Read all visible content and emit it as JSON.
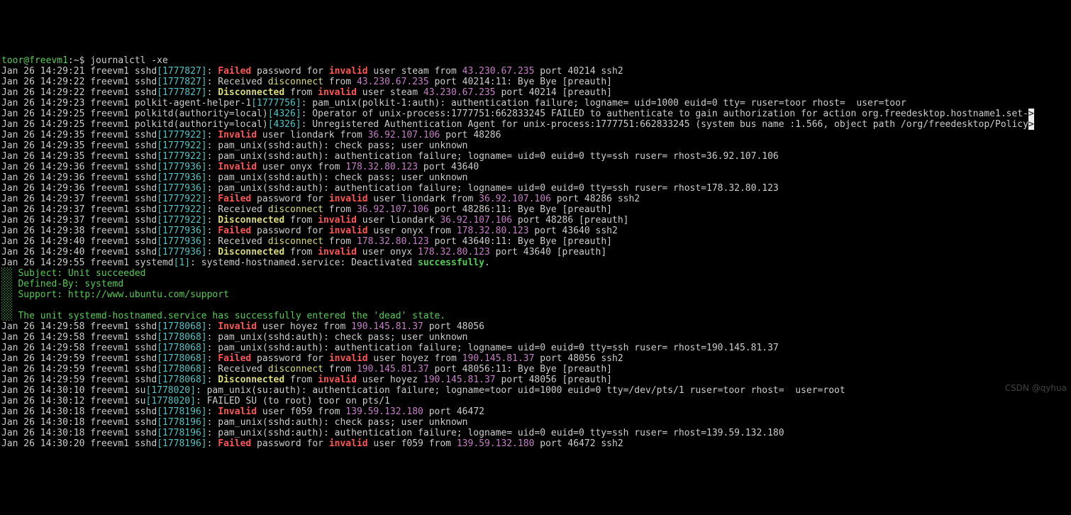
{
  "prompt": {
    "user": "toor@freevm1",
    "path": ":~$ ",
    "command": "journalctl -xe"
  },
  "watermark": "CSDN @qyhua",
  "lines": [
    {
      "segments": [
        {
          "class": "fg-default",
          "text": "Jan 26 14:29:21 freevm1 sshd"
        },
        {
          "class": "fg-cyan",
          "text": "[1777827]"
        },
        {
          "class": "fg-default",
          "text": ": "
        },
        {
          "class": "fg-red-b bold",
          "text": "Failed"
        },
        {
          "class": "fg-default",
          "text": " password for "
        },
        {
          "class": "fg-red-b bold",
          "text": "invalid"
        },
        {
          "class": "fg-default",
          "text": " user steam from "
        },
        {
          "class": "fg-magenta",
          "text": "43.230.67.235"
        },
        {
          "class": "fg-default",
          "text": " port 40214 ssh2"
        }
      ]
    },
    {
      "segments": [
        {
          "class": "fg-default",
          "text": "Jan 26 14:29:22 freevm1 sshd"
        },
        {
          "class": "fg-cyan",
          "text": "[1777827]"
        },
        {
          "class": "fg-default",
          "text": ": Received "
        },
        {
          "class": "fg-yellow",
          "text": "disconnect"
        },
        {
          "class": "fg-default",
          "text": " from "
        },
        {
          "class": "fg-magenta",
          "text": "43.230.67.235"
        },
        {
          "class": "fg-default",
          "text": " port 40214:11: Bye Bye [preauth]"
        }
      ]
    },
    {
      "segments": [
        {
          "class": "fg-default",
          "text": "Jan 26 14:29:22 freevm1 sshd"
        },
        {
          "class": "fg-cyan",
          "text": "[1777827]"
        },
        {
          "class": "fg-default",
          "text": ": "
        },
        {
          "class": "fg-yellow-b",
          "text": "Disconnected"
        },
        {
          "class": "fg-default",
          "text": " from "
        },
        {
          "class": "fg-red-b bold",
          "text": "invalid"
        },
        {
          "class": "fg-default",
          "text": " user steam "
        },
        {
          "class": "fg-magenta",
          "text": "43.230.67.235"
        },
        {
          "class": "fg-default",
          "text": " port 40214 [preauth]"
        }
      ]
    },
    {
      "segments": [
        {
          "class": "fg-default",
          "text": "Jan 26 14:29:23 freevm1 polkit-agent-helper-1"
        },
        {
          "class": "fg-cyan",
          "text": "[1777756]"
        },
        {
          "class": "fg-default",
          "text": ": pam_unix(polkit-1:auth): authentication failure; logname= uid=1000 euid=0 tty= ruser=toor rhost=  user=toor"
        }
      ]
    },
    {
      "segments": [
        {
          "class": "fg-default",
          "text": "Jan 26 14:29:25 freevm1 polkitd(authority=local)"
        },
        {
          "class": "fg-cyan",
          "text": "[4326]"
        },
        {
          "class": "fg-default",
          "text": ": Operator of unix-process:1777751:662833245 FAILED to authenticate to gain authorization for action org.freedesktop.hostname1.set-"
        },
        {
          "class": "bg-white",
          "text": ">"
        }
      ]
    },
    {
      "segments": [
        {
          "class": "fg-default",
          "text": "Jan 26 14:29:25 freevm1 polkitd(authority=local)"
        },
        {
          "class": "fg-cyan",
          "text": "[4326]"
        },
        {
          "class": "fg-default",
          "text": ": Unregistered Authentication Agent for unix-process:1777751:662833245 (system bus name :1.566, object path /org/freedesktop/Policy"
        },
        {
          "class": "bg-white",
          "text": ">"
        }
      ]
    },
    {
      "segments": [
        {
          "class": "fg-default",
          "text": "Jan 26 14:29:35 freevm1 sshd"
        },
        {
          "class": "fg-cyan",
          "text": "[1777922]"
        },
        {
          "class": "fg-default",
          "text": ": "
        },
        {
          "class": "fg-red-b bold",
          "text": "Invalid"
        },
        {
          "class": "fg-default",
          "text": " user liondark from "
        },
        {
          "class": "fg-magenta",
          "text": "36.92.107.106"
        },
        {
          "class": "fg-default",
          "text": " port 48286"
        }
      ]
    },
    {
      "segments": [
        {
          "class": "fg-default",
          "text": "Jan 26 14:29:35 freevm1 sshd"
        },
        {
          "class": "fg-cyan",
          "text": "[1777922]"
        },
        {
          "class": "fg-default",
          "text": ": pam_unix(sshd:auth): check pass; user unknown"
        }
      ]
    },
    {
      "segments": [
        {
          "class": "fg-default",
          "text": "Jan 26 14:29:35 freevm1 sshd"
        },
        {
          "class": "fg-cyan",
          "text": "[1777922]"
        },
        {
          "class": "fg-default",
          "text": ": pam_unix(sshd:auth): authentication failure; logname= uid=0 euid=0 tty=ssh ruser= rhost=36.92.107.106"
        }
      ]
    },
    {
      "segments": [
        {
          "class": "fg-default",
          "text": "Jan 26 14:29:36 freevm1 sshd"
        },
        {
          "class": "fg-cyan",
          "text": "[1777936]"
        },
        {
          "class": "fg-default",
          "text": ": "
        },
        {
          "class": "fg-red-b bold",
          "text": "Invalid"
        },
        {
          "class": "fg-default",
          "text": " user onyx from "
        },
        {
          "class": "fg-magenta",
          "text": "178.32.80.123"
        },
        {
          "class": "fg-default",
          "text": " port 43640"
        }
      ]
    },
    {
      "segments": [
        {
          "class": "fg-default",
          "text": "Jan 26 14:29:36 freevm1 sshd"
        },
        {
          "class": "fg-cyan",
          "text": "[1777936]"
        },
        {
          "class": "fg-default",
          "text": ": pam_unix(sshd:auth): check pass; user unknown"
        }
      ]
    },
    {
      "segments": [
        {
          "class": "fg-default",
          "text": "Jan 26 14:29:36 freevm1 sshd"
        },
        {
          "class": "fg-cyan",
          "text": "[1777936]"
        },
        {
          "class": "fg-default",
          "text": ": pam_unix(sshd:auth): authentication failure; logname= uid=0 euid=0 tty=ssh ruser= rhost=178.32.80.123"
        }
      ]
    },
    {
      "segments": [
        {
          "class": "fg-default",
          "text": "Jan 26 14:29:37 freevm1 sshd"
        },
        {
          "class": "fg-cyan",
          "text": "[1777922]"
        },
        {
          "class": "fg-default",
          "text": ": "
        },
        {
          "class": "fg-red-b bold",
          "text": "Failed"
        },
        {
          "class": "fg-default",
          "text": " password for "
        },
        {
          "class": "fg-red-b bold",
          "text": "invalid"
        },
        {
          "class": "fg-default",
          "text": " user liondark from "
        },
        {
          "class": "fg-magenta",
          "text": "36.92.107.106"
        },
        {
          "class": "fg-default",
          "text": " port 48286 ssh2"
        }
      ]
    },
    {
      "segments": [
        {
          "class": "fg-default",
          "text": "Jan 26 14:29:37 freevm1 sshd"
        },
        {
          "class": "fg-cyan",
          "text": "[1777922]"
        },
        {
          "class": "fg-default",
          "text": ": Received "
        },
        {
          "class": "fg-yellow",
          "text": "disconnect"
        },
        {
          "class": "fg-default",
          "text": " from "
        },
        {
          "class": "fg-magenta",
          "text": "36.92.107.106"
        },
        {
          "class": "fg-default",
          "text": " port 48286:11: Bye Bye [preauth]"
        }
      ]
    },
    {
      "segments": [
        {
          "class": "fg-default",
          "text": "Jan 26 14:29:37 freevm1 sshd"
        },
        {
          "class": "fg-cyan",
          "text": "[1777922]"
        },
        {
          "class": "fg-default",
          "text": ": "
        },
        {
          "class": "fg-yellow-b",
          "text": "Disconnected"
        },
        {
          "class": "fg-default",
          "text": " from "
        },
        {
          "class": "fg-red-b bold",
          "text": "invalid"
        },
        {
          "class": "fg-default",
          "text": " user liondark "
        },
        {
          "class": "fg-magenta",
          "text": "36.92.107.106"
        },
        {
          "class": "fg-default",
          "text": " port 48286 [preauth]"
        }
      ]
    },
    {
      "segments": [
        {
          "class": "fg-default",
          "text": "Jan 26 14:29:38 freevm1 sshd"
        },
        {
          "class": "fg-cyan",
          "text": "[1777936]"
        },
        {
          "class": "fg-default",
          "text": ": "
        },
        {
          "class": "fg-red-b bold",
          "text": "Failed"
        },
        {
          "class": "fg-default",
          "text": " password for "
        },
        {
          "class": "fg-red-b bold",
          "text": "invalid"
        },
        {
          "class": "fg-default",
          "text": " user onyx from "
        },
        {
          "class": "fg-magenta",
          "text": "178.32.80.123"
        },
        {
          "class": "fg-default",
          "text": " port 43640 ssh2"
        }
      ]
    },
    {
      "segments": [
        {
          "class": "fg-default",
          "text": "Jan 26 14:29:40 freevm1 sshd"
        },
        {
          "class": "fg-cyan",
          "text": "[1777936]"
        },
        {
          "class": "fg-default",
          "text": ": Received "
        },
        {
          "class": "fg-yellow",
          "text": "disconnect"
        },
        {
          "class": "fg-default",
          "text": " from "
        },
        {
          "class": "fg-magenta",
          "text": "178.32.80.123"
        },
        {
          "class": "fg-default",
          "text": " port 43640:11: Bye Bye [preauth]"
        }
      ]
    },
    {
      "segments": [
        {
          "class": "fg-default",
          "text": "Jan 26 14:29:40 freevm1 sshd"
        },
        {
          "class": "fg-cyan",
          "text": "[1777936]"
        },
        {
          "class": "fg-default",
          "text": ": "
        },
        {
          "class": "fg-yellow-b",
          "text": "Disconnected"
        },
        {
          "class": "fg-default",
          "text": " from "
        },
        {
          "class": "fg-red-b bold",
          "text": "invalid"
        },
        {
          "class": "fg-default",
          "text": " user onyx "
        },
        {
          "class": "fg-magenta",
          "text": "178.32.80.123"
        },
        {
          "class": "fg-default",
          "text": " port 43640 [preauth]"
        }
      ]
    },
    {
      "segments": [
        {
          "class": "fg-default",
          "text": "Jan 26 14:29:55 freevm1 systemd"
        },
        {
          "class": "fg-cyan",
          "text": "[1]"
        },
        {
          "class": "fg-default",
          "text": ": systemd-hostnamed.service: Deactivated "
        },
        {
          "class": "fg-green bold",
          "text": "successfully"
        },
        {
          "class": "fg-default",
          "text": "."
        }
      ]
    },
    {
      "segments": [
        {
          "class": "fg-green",
          "text": "░░ Subject: Unit succeeded"
        }
      ]
    },
    {
      "segments": [
        {
          "class": "fg-green",
          "text": "░░ Defined-By: systemd"
        }
      ]
    },
    {
      "segments": [
        {
          "class": "fg-green",
          "text": "░░ Support: http://www.ubuntu.com/support"
        }
      ]
    },
    {
      "segments": [
        {
          "class": "fg-green",
          "text": "░░ "
        }
      ]
    },
    {
      "segments": [
        {
          "class": "fg-green",
          "text": "░░ The unit systemd-hostnamed.service has successfully entered the 'dead' state."
        }
      ]
    },
    {
      "segments": [
        {
          "class": "fg-default",
          "text": "Jan 26 14:29:58 freevm1 sshd"
        },
        {
          "class": "fg-cyan",
          "text": "[1778068]"
        },
        {
          "class": "fg-default",
          "text": ": "
        },
        {
          "class": "fg-red-b bold",
          "text": "Invalid"
        },
        {
          "class": "fg-default",
          "text": " user hoyez from "
        },
        {
          "class": "fg-magenta",
          "text": "190.145.81.37"
        },
        {
          "class": "fg-default",
          "text": " port 48056"
        }
      ]
    },
    {
      "segments": [
        {
          "class": "fg-default",
          "text": "Jan 26 14:29:58 freevm1 sshd"
        },
        {
          "class": "fg-cyan",
          "text": "[1778068]"
        },
        {
          "class": "fg-default",
          "text": ": pam_unix(sshd:auth): check pass; user unknown"
        }
      ]
    },
    {
      "segments": [
        {
          "class": "fg-default",
          "text": "Jan 26 14:29:58 freevm1 sshd"
        },
        {
          "class": "fg-cyan",
          "text": "[1778068]"
        },
        {
          "class": "fg-default",
          "text": ": pam_unix(sshd:auth): authentication failure; logname= uid=0 euid=0 tty=ssh ruser= rhost=190.145.81.37"
        }
      ]
    },
    {
      "segments": [
        {
          "class": "fg-default",
          "text": "Jan 26 14:29:59 freevm1 sshd"
        },
        {
          "class": "fg-cyan",
          "text": "[1778068]"
        },
        {
          "class": "fg-default",
          "text": ": "
        },
        {
          "class": "fg-red-b bold",
          "text": "Failed"
        },
        {
          "class": "fg-default",
          "text": " password for "
        },
        {
          "class": "fg-red-b bold",
          "text": "invalid"
        },
        {
          "class": "fg-default",
          "text": " user hoyez from "
        },
        {
          "class": "fg-magenta",
          "text": "190.145.81.37"
        },
        {
          "class": "fg-default",
          "text": " port 48056 ssh2"
        }
      ]
    },
    {
      "segments": [
        {
          "class": "fg-default",
          "text": "Jan 26 14:29:59 freevm1 sshd"
        },
        {
          "class": "fg-cyan",
          "text": "[1778068]"
        },
        {
          "class": "fg-default",
          "text": ": Received "
        },
        {
          "class": "fg-yellow",
          "text": "disconnect"
        },
        {
          "class": "fg-default",
          "text": " from "
        },
        {
          "class": "fg-magenta",
          "text": "190.145.81.37"
        },
        {
          "class": "fg-default",
          "text": " port 48056:11: Bye Bye [preauth]"
        }
      ]
    },
    {
      "segments": [
        {
          "class": "fg-default",
          "text": "Jan 26 14:29:59 freevm1 sshd"
        },
        {
          "class": "fg-cyan",
          "text": "[1778068]"
        },
        {
          "class": "fg-default",
          "text": ": "
        },
        {
          "class": "fg-yellow-b",
          "text": "Disconnected"
        },
        {
          "class": "fg-default",
          "text": " from "
        },
        {
          "class": "fg-red-b bold",
          "text": "invalid"
        },
        {
          "class": "fg-default",
          "text": " user hoyez "
        },
        {
          "class": "fg-magenta",
          "text": "190.145.81.37"
        },
        {
          "class": "fg-default",
          "text": " port 48056 [preauth]"
        }
      ]
    },
    {
      "segments": [
        {
          "class": "fg-default",
          "text": "Jan 26 14:30:10 freevm1 su"
        },
        {
          "class": "fg-cyan",
          "text": "[1778020]"
        },
        {
          "class": "fg-default",
          "text": ": pam_unix(su:auth): authentication failure; logname=toor uid=1000 euid=0 tty=/dev/pts/1 ruser=toor rhost=  user=root"
        }
      ]
    },
    {
      "segments": [
        {
          "class": "fg-default",
          "text": "Jan 26 14:30:12 freevm1 su"
        },
        {
          "class": "fg-cyan",
          "text": "[1778020]"
        },
        {
          "class": "fg-default",
          "text": ": FAILED SU (to root) toor on pts/1"
        }
      ]
    },
    {
      "segments": [
        {
          "class": "fg-default",
          "text": "Jan 26 14:30:18 freevm1 sshd"
        },
        {
          "class": "fg-cyan",
          "text": "[1778196]"
        },
        {
          "class": "fg-default",
          "text": ": "
        },
        {
          "class": "fg-red-b bold",
          "text": "Invalid"
        },
        {
          "class": "fg-default",
          "text": " user f059 from "
        },
        {
          "class": "fg-magenta",
          "text": "139.59.132.180"
        },
        {
          "class": "fg-default",
          "text": " port 46472"
        }
      ]
    },
    {
      "segments": [
        {
          "class": "fg-default",
          "text": "Jan 26 14:30:18 freevm1 sshd"
        },
        {
          "class": "fg-cyan",
          "text": "[1778196]"
        },
        {
          "class": "fg-default",
          "text": ": pam_unix(sshd:auth): check pass; user unknown"
        }
      ]
    },
    {
      "segments": [
        {
          "class": "fg-default",
          "text": "Jan 26 14:30:18 freevm1 sshd"
        },
        {
          "class": "fg-cyan",
          "text": "[1778196]"
        },
        {
          "class": "fg-default",
          "text": ": pam_unix(sshd:auth): authentication failure; logname= uid=0 euid=0 tty=ssh ruser= rhost=139.59.132.180"
        }
      ]
    },
    {
      "segments": [
        {
          "class": "fg-default",
          "text": "Jan 26 14:30:20 freevm1 sshd"
        },
        {
          "class": "fg-cyan",
          "text": "[1778196]"
        },
        {
          "class": "fg-default",
          "text": ": "
        },
        {
          "class": "fg-red-b bold",
          "text": "Failed"
        },
        {
          "class": "fg-default",
          "text": " password for "
        },
        {
          "class": "fg-red-b bold",
          "text": "invalid"
        },
        {
          "class": "fg-default",
          "text": " user f059 from "
        },
        {
          "class": "fg-magenta",
          "text": "139.59.132.180"
        },
        {
          "class": "fg-default",
          "text": " port 46472 ssh2"
        }
      ]
    }
  ]
}
